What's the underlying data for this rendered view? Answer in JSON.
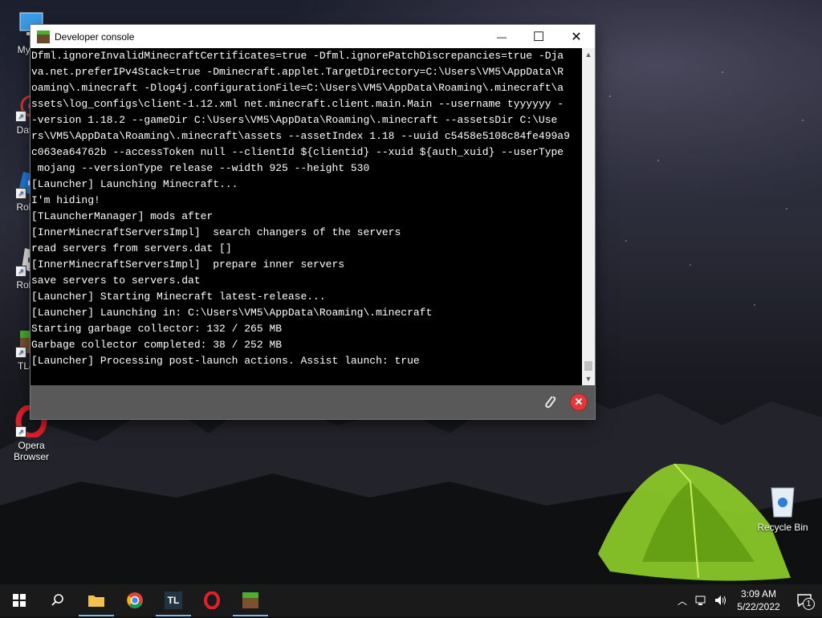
{
  "desktop": {
    "icons": [
      {
        "label": "My Co"
      },
      {
        "label": "DataW"
      },
      {
        "label": "Roblox"
      },
      {
        "label": "Roblox"
      },
      {
        "label": "TLaun"
      },
      {
        "label": "Opera Browser"
      }
    ],
    "recycle_bin": {
      "label": "Recycle Bin"
    }
  },
  "window": {
    "title": "Developer console",
    "controls": {
      "minimize": "—",
      "maximize": "☐",
      "close": "✕"
    },
    "console_lines": [
      "Dfml.ignoreInvalidMinecraftCertificates=true -Dfml.ignorePatchDiscrepancies=true -Dja",
      "va.net.preferIPv4Stack=true -Dminecraft.applet.TargetDirectory=C:\\Users\\VM5\\AppData\\R",
      "oaming\\.minecraft -Dlog4j.configurationFile=C:\\Users\\VM5\\AppData\\Roaming\\.minecraft\\a",
      "ssets\\log_configs\\client-1.12.xml net.minecraft.client.main.Main --username tyyyyyy -",
      "-version 1.18.2 --gameDir C:\\Users\\VM5\\AppData\\Roaming\\.minecraft --assetsDir C:\\Use",
      "rs\\VM5\\AppData\\Roaming\\.minecraft\\assets --assetIndex 1.18 --uuid c5458e5108c84fe499a9",
      "c063ea64762b --accessToken null --clientId ${clientid} --xuid ${auth_xuid} --userType",
      " mojang --versionType release --width 925 --height 530",
      "[Launcher] Launching Minecraft...",
      "I'm hiding!",
      "[TLauncherManager] mods after",
      "[InnerMinecraftServersImpl]  search changers of the servers",
      "read servers from servers.dat []",
      "[InnerMinecraftServersImpl]  prepare inner servers",
      "save servers to servers.dat",
      "[Launcher] Starting Minecraft latest-release...",
      "[Launcher] Launching in: C:\\Users\\VM5\\AppData\\Roaming\\.minecraft",
      "Starting garbage collector: 132 / 265 MB",
      "Garbage collector completed: 38 / 252 MB",
      "[Launcher] Processing post-launch actions. Assist launch: true"
    ]
  },
  "taskbar": {
    "clock_time": "3:09 AM",
    "clock_date": "5/22/2022",
    "notification_count": "1"
  },
  "colors": {
    "console_bg": "#000000",
    "console_fg": "#ffffff",
    "taskbar_bg": "#1a1a1a",
    "accent": "#76b9ed",
    "close_red": "#e03a3a"
  }
}
